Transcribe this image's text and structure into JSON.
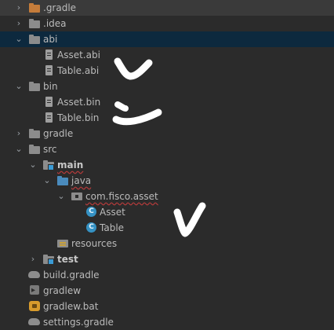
{
  "tree": {
    "items": [
      {
        "label": ".gradle",
        "icon": "folder-orange-icon",
        "arrow": "›"
      },
      {
        "label": ".idea",
        "icon": "folder-icon",
        "arrow": "›"
      },
      {
        "label": "abi",
        "icon": "folder-icon",
        "arrow": "⌄"
      },
      {
        "label": "Asset.abi",
        "icon": "file-icon"
      },
      {
        "label": "Table.abi",
        "icon": "file-icon"
      },
      {
        "label": "bin",
        "icon": "folder-icon",
        "arrow": "⌄"
      },
      {
        "label": "Asset.bin",
        "icon": "file-icon"
      },
      {
        "label": "Table.bin",
        "icon": "file-icon"
      },
      {
        "label": "gradle",
        "icon": "folder-icon",
        "arrow": "›"
      },
      {
        "label": "src",
        "icon": "folder-icon",
        "arrow": "⌄"
      },
      {
        "label": "main",
        "icon": "module-folder-icon",
        "arrow": "⌄"
      },
      {
        "label": "java",
        "icon": "source-folder-icon",
        "arrow": "⌄"
      },
      {
        "label": "com.fisco.asset",
        "icon": "package-icon",
        "arrow": "⌄"
      },
      {
        "label": "Asset",
        "icon": "class-icon"
      },
      {
        "label": "Table",
        "icon": "class-icon"
      },
      {
        "label": "resources",
        "icon": "resources-folder-icon"
      },
      {
        "label": "test",
        "icon": "module-folder-icon",
        "arrow": "›"
      },
      {
        "label": "build.gradle",
        "icon": "gradle-elephant-icon"
      },
      {
        "label": "gradlew",
        "icon": "script-icon"
      },
      {
        "label": "gradlew.bat",
        "icon": "bat-file-icon"
      },
      {
        "label": "settings.gradle",
        "icon": "gradle-elephant-icon"
      }
    ],
    "class_glyph": "C"
  },
  "colors": {
    "background": "#2b2b2b",
    "selected_row": "#0d293e",
    "text": "#bbbbbb",
    "folder": "#8c8c8c",
    "accent_blue": "#3592c4",
    "error_underline": "#b33a3a"
  }
}
